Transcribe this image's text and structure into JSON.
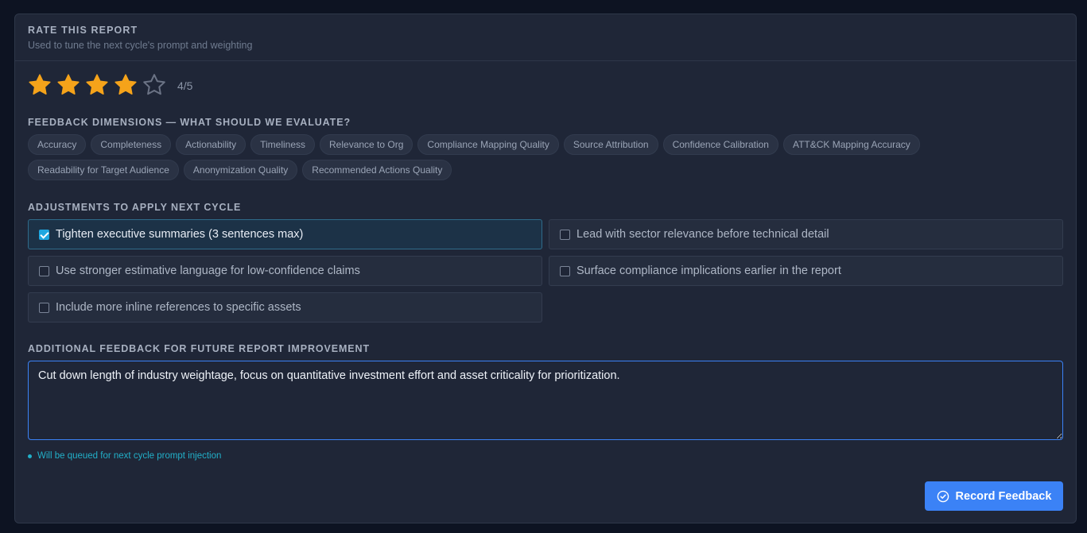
{
  "header": {
    "title": "RATE THIS REPORT",
    "subtitle": "Used to tune the next cycle's prompt and weighting"
  },
  "rating": {
    "value": 4,
    "max": 5,
    "display": "4/5",
    "filled_color": "#f5a31a",
    "empty_color": "#6b7385"
  },
  "dimensions": {
    "label": "FEEDBACK DIMENSIONS — WHAT SHOULD WE EVALUATE?",
    "chips": [
      "Accuracy",
      "Completeness",
      "Actionability",
      "Timeliness",
      "Relevance to Org",
      "Compliance Mapping Quality",
      "Source Attribution",
      "Confidence Calibration",
      "ATT&CK Mapping Accuracy",
      "Readability for Target Audience",
      "Anonymization Quality",
      "Recommended Actions Quality"
    ]
  },
  "adjustments": {
    "label": "ADJUSTMENTS TO APPLY NEXT CYCLE",
    "items": [
      {
        "label": "Tighten executive summaries (3 sentences max)",
        "checked": true
      },
      {
        "label": "Lead with sector relevance before technical detail",
        "checked": false
      },
      {
        "label": "Use stronger estimative language for low-confidence claims",
        "checked": false
      },
      {
        "label": "Surface compliance implications earlier in the report",
        "checked": false
      },
      {
        "label": "Include more inline references to specific assets",
        "checked": false
      }
    ]
  },
  "additional_feedback": {
    "label": "ADDITIONAL FEEDBACK FOR FUTURE REPORT IMPROVEMENT",
    "value": "Cut down length of industry weightage, focus on quantitative investment effort and asset criticality for prioritization.\n"
  },
  "status": {
    "text": "Will be queued for next cycle prompt injection",
    "color": "#22b0c9"
  },
  "actions": {
    "record_label": "Record Feedback",
    "record_icon": "check-circle-icon",
    "accent": "#3b82f6"
  }
}
